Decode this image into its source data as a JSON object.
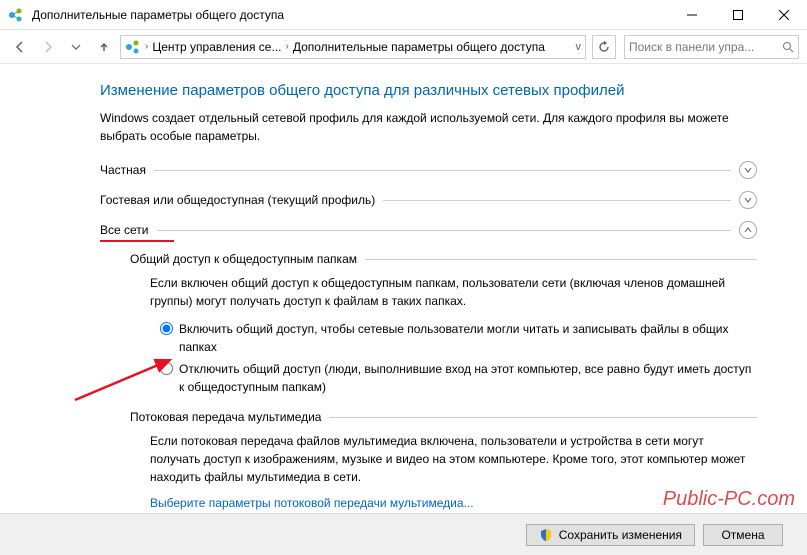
{
  "titlebar": {
    "title": "Дополнительные параметры общего доступа"
  },
  "breadcrumb": {
    "level1": "Центр управления се...",
    "level2": "Дополнительные параметры общего доступа"
  },
  "search": {
    "placeholder": "Поиск в панели упра..."
  },
  "page": {
    "heading": "Изменение параметров общего доступа для различных сетевых профилей",
    "subtitle": "Windows создает отдельный сетевой профиль для каждой используемой сети. Для каждого профиля вы можете выбрать особые параметры."
  },
  "sections": {
    "private": "Частная",
    "guest": "Гостевая или общедоступная (текущий профиль)",
    "allnets": "Все сети"
  },
  "publicFolders": {
    "header": "Общий доступ к общедоступным папкам",
    "desc": "Если включен общий доступ к общедоступным папкам, пользователи сети (включая членов домашней группы) могут получать доступ к файлам в таких папках.",
    "optOn": "Включить общий доступ, чтобы сетевые пользователи могли читать и записывать файлы в общих папках",
    "optOff": "Отключить общий доступ (люди, выполнившие вход на этот компьютер, все равно будут иметь доступ к общедоступным папкам)"
  },
  "media": {
    "header": "Потоковая передача мультимедиа",
    "desc": "Если потоковая передача файлов мультимедиа включена, пользователи и устройства в сети могут получать доступ к изображениям, музыке и видео на этом компьютере. Кроме того, этот компьютер может находить файлы мультимедиа в сети.",
    "link": "Выберите параметры потоковой передачи мультимедиа..."
  },
  "footer": {
    "save": "Сохранить изменения",
    "cancel": "Отмена"
  },
  "watermark": "Public-PC.com"
}
